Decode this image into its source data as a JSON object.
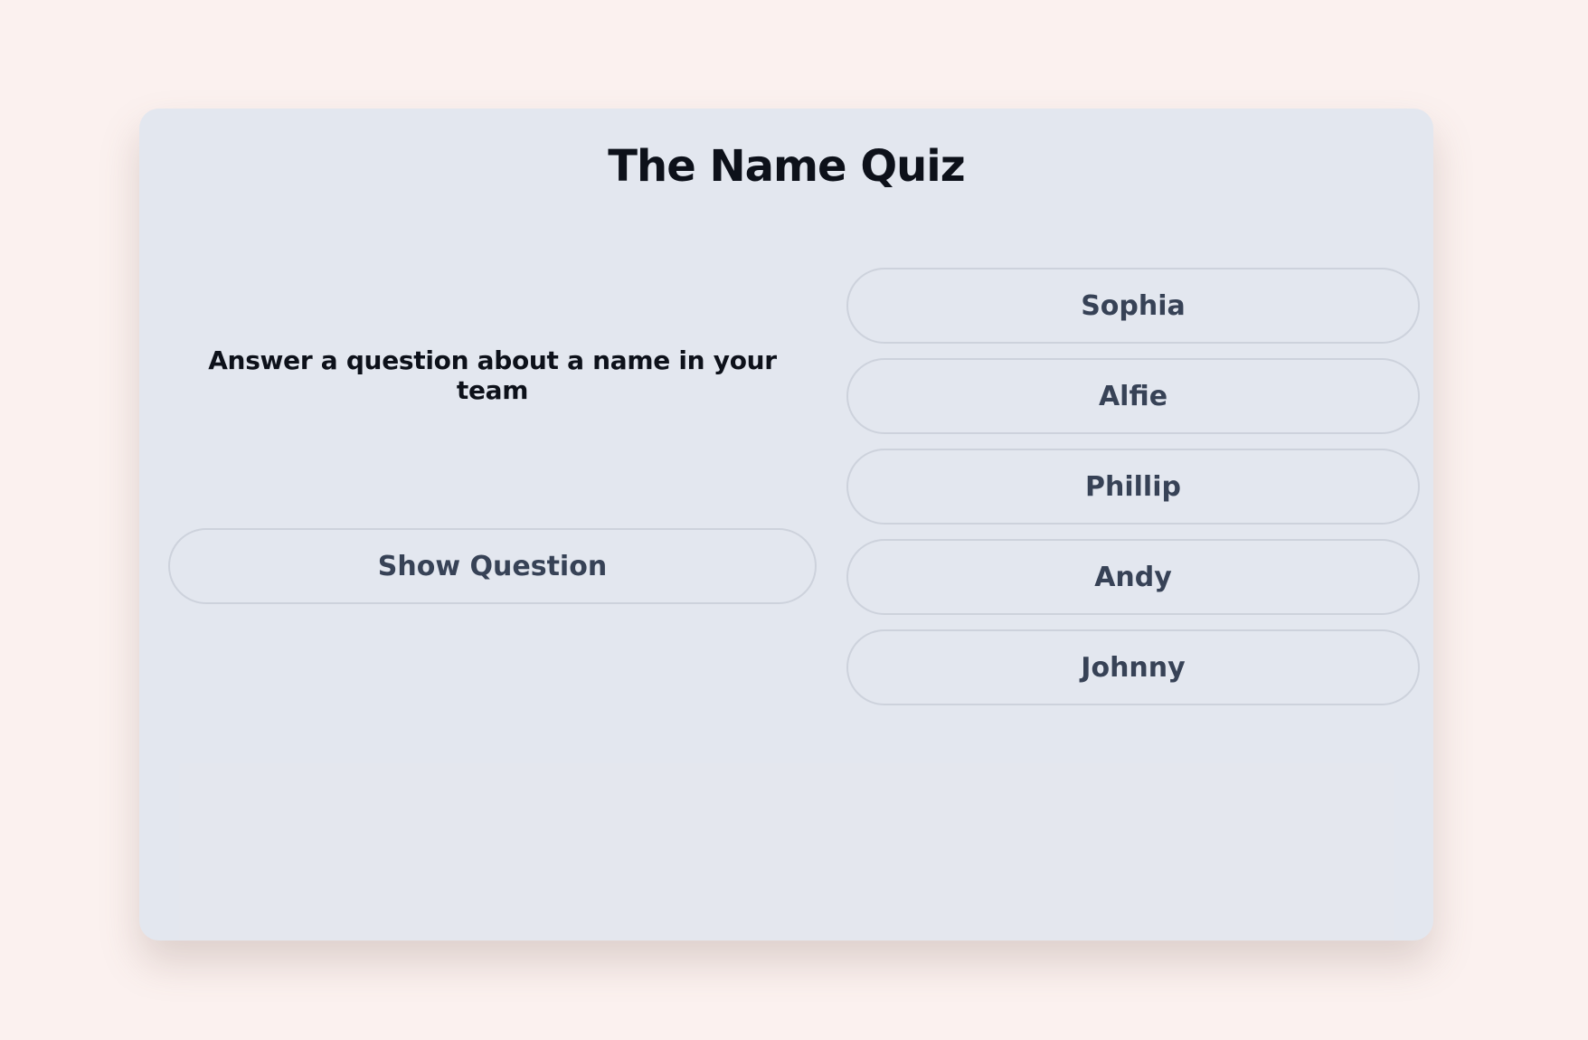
{
  "quiz": {
    "title": "The Name Quiz",
    "prompt": "Answer a question about a name in your team",
    "show_question_label": "Show Question",
    "answers": [
      "Sophia",
      "Alfie",
      "Phillip",
      "Andy",
      "Johnny"
    ]
  },
  "colors": {
    "page_background": "#fbf1ef",
    "card_background": "#e3e7ef",
    "title_text": "#0d111a",
    "button_text": "#374256",
    "button_border": "#cdd2dc"
  }
}
